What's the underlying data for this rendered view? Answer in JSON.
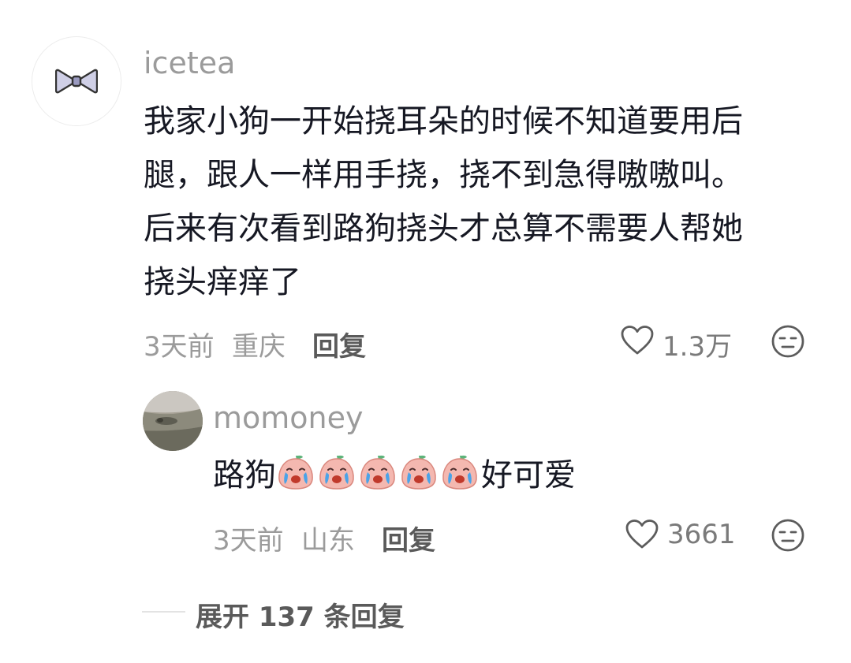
{
  "comment": {
    "username": "icetea",
    "text_lines": [
      "我家小狗一开始挠耳朵的时候不知道要用后",
      "腿，跟人一样用手挠，挠不到急得嗷嗷叫。",
      "后来有次看到路狗挠头才总算不需要人帮她",
      "挠头痒痒了"
    ],
    "time": "3天前",
    "location": "重庆",
    "reply_label": "回复",
    "like_count": "1.3万"
  },
  "reply": {
    "username": "momoney",
    "text_before": "路狗",
    "emoji_name": "crying-peach-emoji",
    "emoji_count": 5,
    "text_after": "好可爱",
    "time": "3天前",
    "location": "山东",
    "reply_label": "回复",
    "like_count": "3661"
  },
  "expand": {
    "label": "展开 137 条回复"
  },
  "icons": {
    "avatar_main": "bow-tie-icon",
    "like": "heart-outline-icon",
    "dislike": "neutral-face-icon"
  },
  "colors": {
    "text_primary": "#161823",
    "text_secondary": "#9b9b9b",
    "reply_button": "#5a5a5a"
  }
}
